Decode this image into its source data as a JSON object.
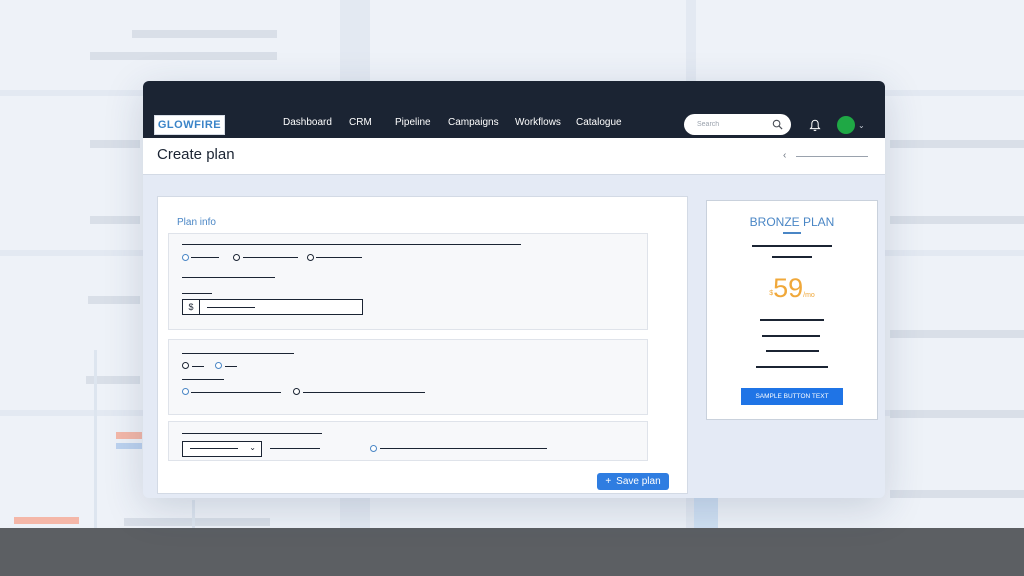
{
  "app": {
    "logo_text": "GLOWFIRE"
  },
  "nav": {
    "items": [
      {
        "label": "Dashboard"
      },
      {
        "label": "CRM"
      },
      {
        "label": "Pipeline"
      },
      {
        "label": "Campaigns"
      },
      {
        "label": "Workflows"
      },
      {
        "label": "Catalogue"
      }
    ]
  },
  "search": {
    "placeholder": "Search"
  },
  "header": {
    "title": "Create plan"
  },
  "form": {
    "section_title": "Plan info",
    "currency_symbol": "$",
    "save_button_label": "Save plan",
    "save_button_icon": "+"
  },
  "plan_card": {
    "name": "BRONZE PLAN",
    "currency": "$",
    "price": "59",
    "period": "/mo",
    "button_label": "SAMPLE BUTTON TEXT"
  },
  "colors": {
    "topbar": "#1b2433",
    "accent_blue": "#2f7de1",
    "price_orange": "#f0a83a",
    "avatar_green": "#1fa845"
  },
  "icons": {
    "search": "search-icon",
    "notifications": "bell-icon",
    "back": "chevron-left-icon",
    "dropdown": "chevron-down-icon"
  }
}
